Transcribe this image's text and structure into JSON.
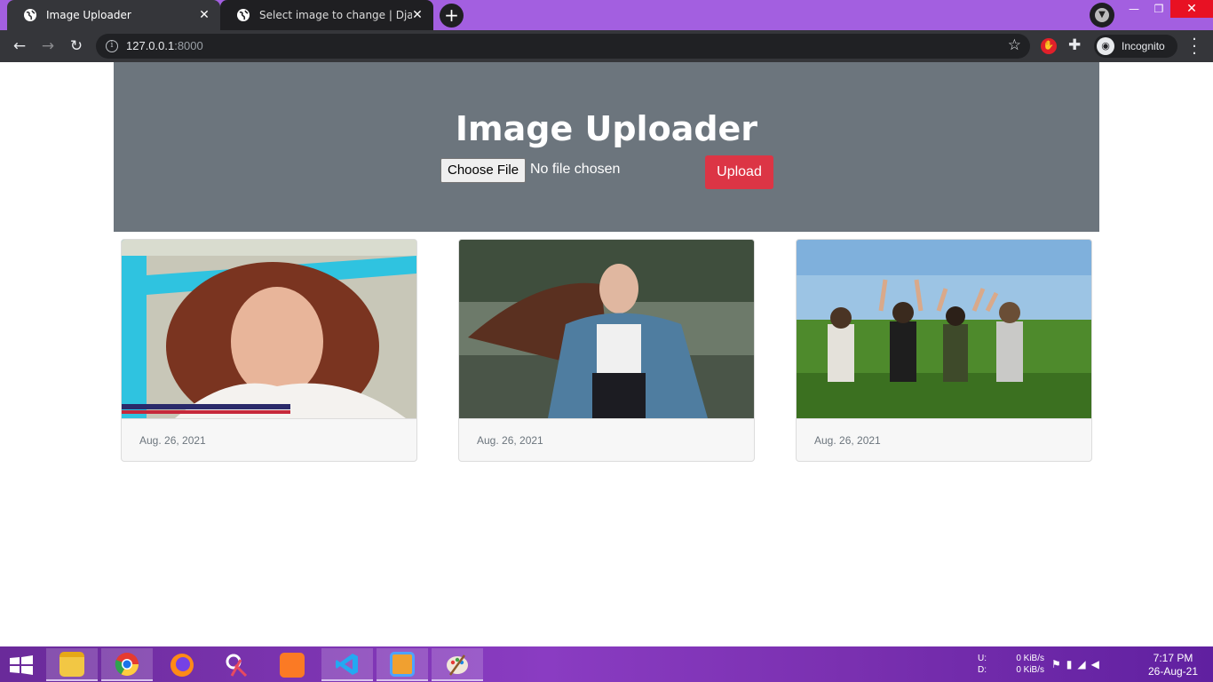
{
  "browser": {
    "tabs": [
      {
        "title": "Image Uploader",
        "active": true
      },
      {
        "title": "Select image to change | Django",
        "active": false
      }
    ],
    "url_host": "127.0.0.1",
    "url_port": ":8000",
    "incognito_label": "Incognito",
    "colors": {
      "frame": "#a35fe0",
      "toolbar": "#35363a"
    }
  },
  "page": {
    "title": "Image Uploader",
    "file_button_label": "Choose File",
    "file_status": "No file chosen",
    "upload_button_label": "Upload",
    "colors": {
      "hero": "#6c757d",
      "upload": "#dc3545"
    },
    "cards": [
      {
        "image": "woman-portrait-photo",
        "date": "Aug. 26, 2021"
      },
      {
        "image": "woman-denim-jacket-photo",
        "date": "Aug. 26, 2021"
      },
      {
        "image": "friends-in-field-photo",
        "date": "Aug. 26, 2021"
      }
    ]
  },
  "taskbar": {
    "apps": [
      "file-explorer",
      "chrome",
      "firefox",
      "snipping-tool",
      "xampp",
      "vscode",
      "media-player",
      "paint"
    ],
    "net_labels": {
      "up": "U:",
      "down": "D:"
    },
    "net_rates": {
      "up": "0 KiB/s",
      "down": "0 KiB/s"
    },
    "time": "7:17 PM",
    "date": "26-Aug-21"
  }
}
